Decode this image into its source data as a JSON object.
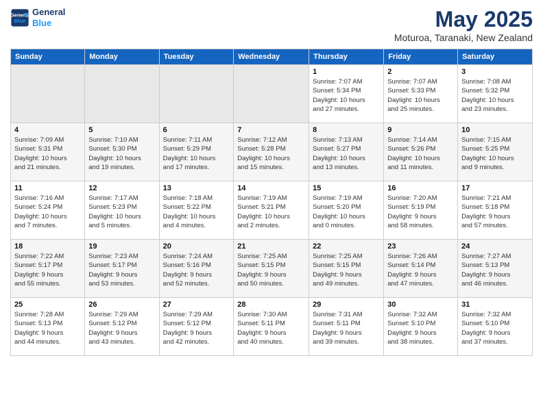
{
  "header": {
    "logo_line1": "General",
    "logo_line2": "Blue",
    "month": "May 2025",
    "location": "Moturoa, Taranaki, New Zealand"
  },
  "days_of_week": [
    "Sunday",
    "Monday",
    "Tuesday",
    "Wednesday",
    "Thursday",
    "Friday",
    "Saturday"
  ],
  "weeks": [
    [
      {
        "num": "",
        "info": ""
      },
      {
        "num": "",
        "info": ""
      },
      {
        "num": "",
        "info": ""
      },
      {
        "num": "",
        "info": ""
      },
      {
        "num": "1",
        "info": "Sunrise: 7:07 AM\nSunset: 5:34 PM\nDaylight: 10 hours\nand 27 minutes."
      },
      {
        "num": "2",
        "info": "Sunrise: 7:07 AM\nSunset: 5:33 PM\nDaylight: 10 hours\nand 25 minutes."
      },
      {
        "num": "3",
        "info": "Sunrise: 7:08 AM\nSunset: 5:32 PM\nDaylight: 10 hours\nand 23 minutes."
      }
    ],
    [
      {
        "num": "4",
        "info": "Sunrise: 7:09 AM\nSunset: 5:31 PM\nDaylight: 10 hours\nand 21 minutes."
      },
      {
        "num": "5",
        "info": "Sunrise: 7:10 AM\nSunset: 5:30 PM\nDaylight: 10 hours\nand 19 minutes."
      },
      {
        "num": "6",
        "info": "Sunrise: 7:11 AM\nSunset: 5:29 PM\nDaylight: 10 hours\nand 17 minutes."
      },
      {
        "num": "7",
        "info": "Sunrise: 7:12 AM\nSunset: 5:28 PM\nDaylight: 10 hours\nand 15 minutes."
      },
      {
        "num": "8",
        "info": "Sunrise: 7:13 AM\nSunset: 5:27 PM\nDaylight: 10 hours\nand 13 minutes."
      },
      {
        "num": "9",
        "info": "Sunrise: 7:14 AM\nSunset: 5:26 PM\nDaylight: 10 hours\nand 11 minutes."
      },
      {
        "num": "10",
        "info": "Sunrise: 7:15 AM\nSunset: 5:25 PM\nDaylight: 10 hours\nand 9 minutes."
      }
    ],
    [
      {
        "num": "11",
        "info": "Sunrise: 7:16 AM\nSunset: 5:24 PM\nDaylight: 10 hours\nand 7 minutes."
      },
      {
        "num": "12",
        "info": "Sunrise: 7:17 AM\nSunset: 5:23 PM\nDaylight: 10 hours\nand 5 minutes."
      },
      {
        "num": "13",
        "info": "Sunrise: 7:18 AM\nSunset: 5:22 PM\nDaylight: 10 hours\nand 4 minutes."
      },
      {
        "num": "14",
        "info": "Sunrise: 7:19 AM\nSunset: 5:21 PM\nDaylight: 10 hours\nand 2 minutes."
      },
      {
        "num": "15",
        "info": "Sunrise: 7:19 AM\nSunset: 5:20 PM\nDaylight: 10 hours\nand 0 minutes."
      },
      {
        "num": "16",
        "info": "Sunrise: 7:20 AM\nSunset: 5:19 PM\nDaylight: 9 hours\nand 58 minutes."
      },
      {
        "num": "17",
        "info": "Sunrise: 7:21 AM\nSunset: 5:18 PM\nDaylight: 9 hours\nand 57 minutes."
      }
    ],
    [
      {
        "num": "18",
        "info": "Sunrise: 7:22 AM\nSunset: 5:17 PM\nDaylight: 9 hours\nand 55 minutes."
      },
      {
        "num": "19",
        "info": "Sunrise: 7:23 AM\nSunset: 5:17 PM\nDaylight: 9 hours\nand 53 minutes."
      },
      {
        "num": "20",
        "info": "Sunrise: 7:24 AM\nSunset: 5:16 PM\nDaylight: 9 hours\nand 52 minutes."
      },
      {
        "num": "21",
        "info": "Sunrise: 7:25 AM\nSunset: 5:15 PM\nDaylight: 9 hours\nand 50 minutes."
      },
      {
        "num": "22",
        "info": "Sunrise: 7:25 AM\nSunset: 5:15 PM\nDaylight: 9 hours\nand 49 minutes."
      },
      {
        "num": "23",
        "info": "Sunrise: 7:26 AM\nSunset: 5:14 PM\nDaylight: 9 hours\nand 47 minutes."
      },
      {
        "num": "24",
        "info": "Sunrise: 7:27 AM\nSunset: 5:13 PM\nDaylight: 9 hours\nand 46 minutes."
      }
    ],
    [
      {
        "num": "25",
        "info": "Sunrise: 7:28 AM\nSunset: 5:13 PM\nDaylight: 9 hours\nand 44 minutes."
      },
      {
        "num": "26",
        "info": "Sunrise: 7:29 AM\nSunset: 5:12 PM\nDaylight: 9 hours\nand 43 minutes."
      },
      {
        "num": "27",
        "info": "Sunrise: 7:29 AM\nSunset: 5:12 PM\nDaylight: 9 hours\nand 42 minutes."
      },
      {
        "num": "28",
        "info": "Sunrise: 7:30 AM\nSunset: 5:11 PM\nDaylight: 9 hours\nand 40 minutes."
      },
      {
        "num": "29",
        "info": "Sunrise: 7:31 AM\nSunset: 5:11 PM\nDaylight: 9 hours\nand 39 minutes."
      },
      {
        "num": "30",
        "info": "Sunrise: 7:32 AM\nSunset: 5:10 PM\nDaylight: 9 hours\nand 38 minutes."
      },
      {
        "num": "31",
        "info": "Sunrise: 7:32 AM\nSunset: 5:10 PM\nDaylight: 9 hours\nand 37 minutes."
      }
    ]
  ]
}
